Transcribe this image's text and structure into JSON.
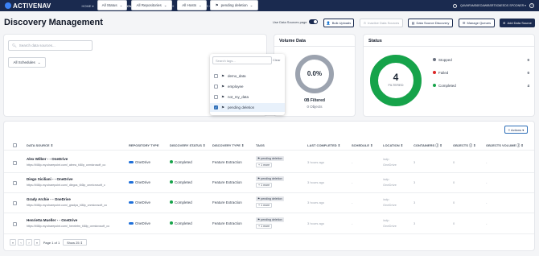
{
  "nav": {
    "brand": "ACTIVENAV",
    "items": [
      "HOME ▾",
      "REVIEW",
      "DISCOVERY ▾",
      "TARGET SEARCH",
      "BUSINESS RULES ▾",
      "SYSTEM ▾"
    ],
    "active": "DISCOVERY ▾",
    "user": "QAVMFAMS6EOAWIBSRT0O6EEDS SPOONER ▾",
    "help": "?"
  },
  "header": {
    "title": "Discovery Management",
    "toggle_label": "Use Data Sources page",
    "buttons": {
      "bulk": "Bulk Uploads",
      "inactive": "Inactive Data Sources",
      "ds_discovery": "Data Source Discovery",
      "queues": "Manage Queues",
      "add": "Add Data Source"
    }
  },
  "filters": {
    "search_placeholder": "Search data sources...",
    "status": "All Status",
    "repos": "All Repositories",
    "hosts": "All Hosts",
    "tag": "pending deletion",
    "schedules": "All Schedules"
  },
  "tag_dropdown": {
    "search_placeholder": "Search tags...",
    "clear": "Clear",
    "options": [
      {
        "label": "demo_data",
        "checked": false
      },
      {
        "label": "employee",
        "checked": false
      },
      {
        "label": "not_my_data",
        "checked": false
      },
      {
        "label": "pending deletion",
        "checked": true
      }
    ]
  },
  "volume": {
    "title": "Volume Data",
    "percent": "0.0%",
    "filtered": "0B Filtered",
    "objects": "0 Objects"
  },
  "status": {
    "title": "Status",
    "total": "4",
    "total_label": "FILTERED",
    "legend": [
      {
        "label": "Stopped",
        "count": "0",
        "color": "#6b7280"
      },
      {
        "label": "Failed",
        "count": "0",
        "color": "#dc2626"
      },
      {
        "label": "Completed",
        "count": "4",
        "color": "#16a34a"
      }
    ],
    "completed_fraction": 1.0
  },
  "table": {
    "actions": "≡ Actions ▾",
    "headers": {
      "source": "DATA SOURCE ⇕",
      "repo": "REPOSITORY TYPE",
      "status": "DISCOVERY STATUS ⇕",
      "dtype": "DISCOVERY TYPE ⇕",
      "tags": "TAGS",
      "last": "LAST COMPLETED ⇕",
      "schedule": "SCHEDULE ⇕",
      "location": "LOCATION ⇕",
      "containers": "CONTAINERS ⓘ ⇕",
      "objects": "OBJECTS ⓘ ⇕",
      "volume": "OBJECTS VOLUME ⓘ ⇕"
    },
    "rows": [
      {
        "name": "Alex Wilber - - OneDrive",
        "url": "https://t46lp-my.sharepoint.com/_alexw_t46lp_onmicrosoft_co",
        "repo": "OneDrive",
        "status": "Completed",
        "dtype": "Feature Extraction",
        "tag": "⚑ pending deletion",
        "more": "+ 1 more",
        "last": "3 hours ago",
        "schedule": "-",
        "loc1": "/sdp",
        "loc2": "OneDrive",
        "containers": "3",
        "objects": "0",
        "volume": "-"
      },
      {
        "name": "Diego Siciliani - - OneDrive",
        "url": "https://t46lp-my.sharepoint.com/_diegos_t46lp_onmicrosoft_c",
        "repo": "OneDrive",
        "status": "Completed",
        "dtype": "Feature Extraction",
        "tag": "⚑ pending deletion",
        "more": "+ 1 more",
        "last": "3 hours ago",
        "schedule": "-",
        "loc1": "/sdp",
        "loc2": "OneDrive",
        "containers": "3",
        "objects": "0",
        "volume": "-"
      },
      {
        "name": "Grady Archie - - OneDrive",
        "url": "https://t46lp-my.sharepoint.com/_gradya_t46lp_onmicrosoft_co",
        "repo": "OneDrive",
        "status": "Completed",
        "dtype": "Feature Extraction",
        "tag": "⚑ pending deletion",
        "more": "+ 1 more",
        "last": "3 hours ago",
        "schedule": "-",
        "loc1": "/sdp",
        "loc2": "OneDrive",
        "containers": "3",
        "objects": "0",
        "volume": "-"
      },
      {
        "name": "Henrietta Mueller - - OneDrive",
        "url": "https://t46lp-my.sharepoint.com/_henrietm_t46lp_onmicrosoft_co",
        "repo": "OneDrive",
        "status": "Completed",
        "dtype": "Feature Extraction",
        "tag": "⚑ pending deletion",
        "more": "+ 1 more",
        "last": "3 hours ago",
        "schedule": "-",
        "loc1": "/sdp",
        "loc2": "OneDrive",
        "containers": "3",
        "objects": "0",
        "volume": "-"
      }
    ]
  },
  "pagination": {
    "first": "«",
    "prev": "‹",
    "next": "›",
    "last": "»",
    "page_label": "Page 1 of 1",
    "show": "Show 25 ⇕"
  }
}
